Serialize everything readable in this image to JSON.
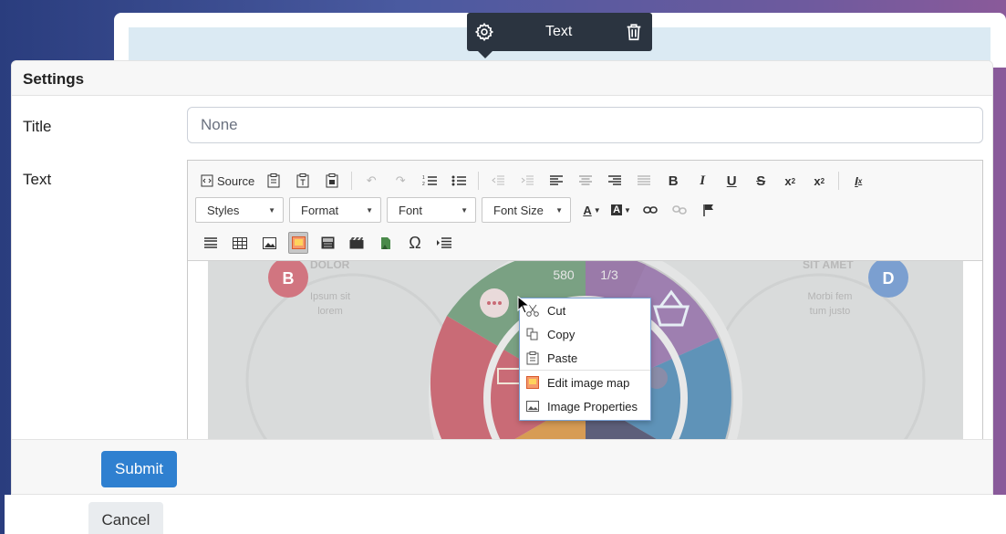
{
  "floating_toolbar": {
    "label": "Text",
    "gear_icon": "gear-icon",
    "trash_icon": "trash-icon"
  },
  "modal": {
    "title": "Settings",
    "fields": {
      "title_label": "Title",
      "title_value": "None",
      "text_label": "Text"
    }
  },
  "editor": {
    "source_label": "Source",
    "combos": [
      "Styles",
      "Format",
      "Font",
      "Font Size"
    ],
    "infographic_text": {
      "dolor": "DOLOR",
      "ipsum": "Ipsum sit",
      "lorem": "lorem",
      "sit_amet": "SIT AMET",
      "morbi": "Morbi fem",
      "tum_justo": "tum justo",
      "badge_b": "B",
      "badge_d": "D",
      "stat_580": "580",
      "stat_13": "1/3"
    }
  },
  "context_menu": {
    "items": [
      "Cut",
      "Copy",
      "Paste",
      "Edit image map",
      "Image Properties"
    ]
  },
  "footer": {
    "submit": "Submit",
    "cancel": "Cancel"
  },
  "colors": {
    "accent": "#2f80d0",
    "toolbar_dark": "#2b3440",
    "menu_border": "#7aa3d6"
  }
}
